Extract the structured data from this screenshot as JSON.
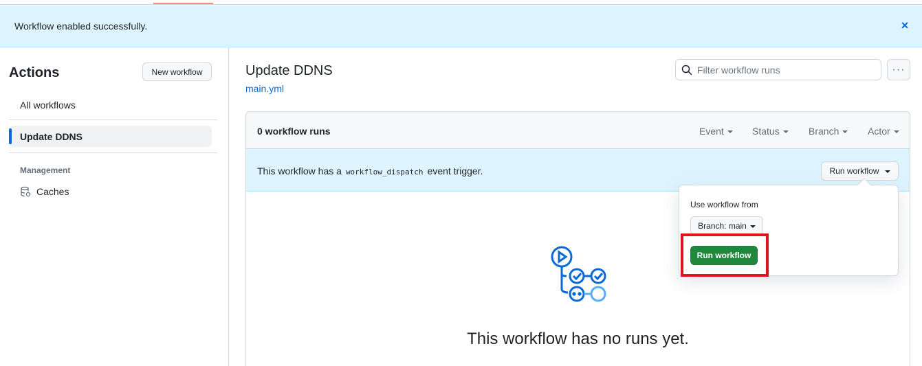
{
  "flash": {
    "message": "Workflow enabled successfully.",
    "close_icon": "x-icon"
  },
  "sidebar": {
    "title": "Actions",
    "new_workflow": "New workflow",
    "all_workflows": "All workflows",
    "active_item": "Update DDNS",
    "management_heading": "Management",
    "caches": "Caches",
    "caches_icon": "database-icon"
  },
  "main": {
    "title": "Update DDNS",
    "file_link": "main.yml",
    "filter_placeholder": "Filter workflow runs",
    "more_icon": "kebab-horizontal-icon",
    "run_count": "0 workflow runs",
    "filters": [
      "Event",
      "Status",
      "Branch",
      "Actor"
    ],
    "dispatch_prefix": "This workflow has a",
    "dispatch_code": "workflow_dispatch",
    "dispatch_suffix": "event trigger.",
    "run_workflow_button": "Run workflow",
    "empty_title": "This workflow has no runs yet."
  },
  "popover": {
    "use_from": "Use workflow from",
    "branch_button": "Branch: main",
    "run_button": "Run workflow"
  },
  "colors": {
    "accent": "#0969da",
    "flash_bg": "#ddf4ff",
    "primary_button": "#1f883d",
    "highlight": "#e0141e"
  }
}
